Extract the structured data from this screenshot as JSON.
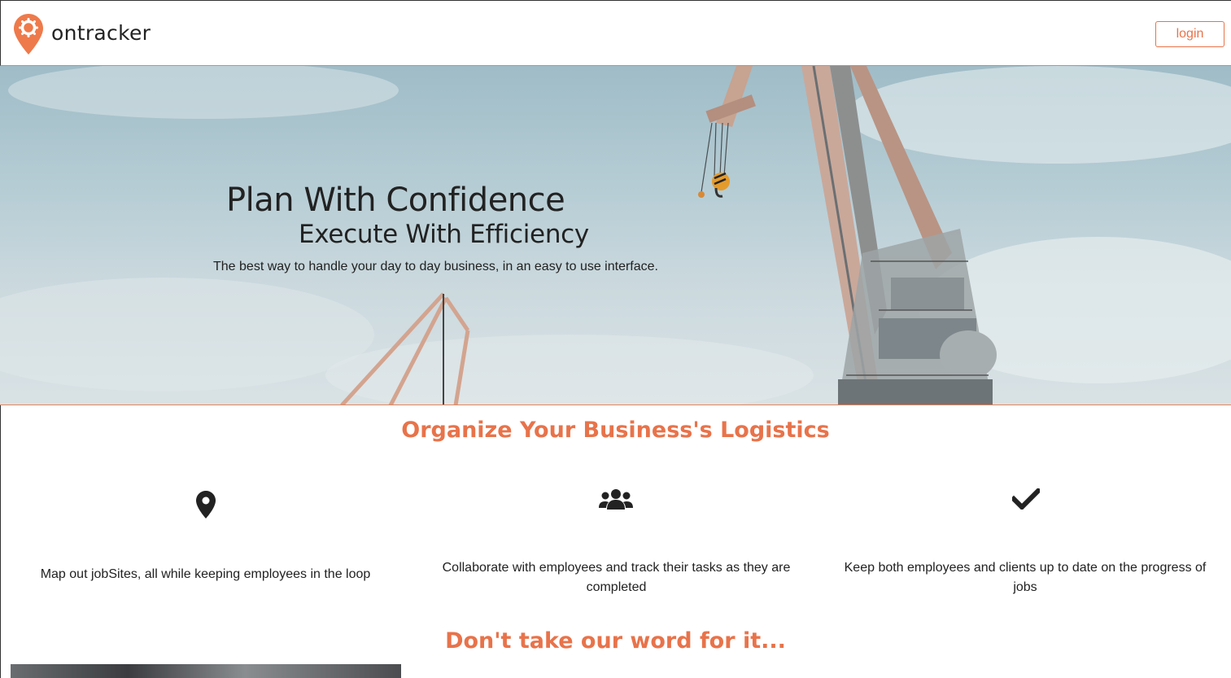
{
  "brand": {
    "name": "ontracker",
    "accent": "#e8734a"
  },
  "nav": {
    "login_label": "login"
  },
  "hero": {
    "title": "Plan With Confidence",
    "subtitle": "Execute With Efficiency",
    "tagline": "The best way to handle your day to day business, in an easy to use interface."
  },
  "features_section": {
    "title": "Organize Your Business's Logistics",
    "items": [
      {
        "icon": "map-marker-icon",
        "text": "Map out jobSites, all while keeping employees in the loop"
      },
      {
        "icon": "users-icon",
        "text": "Collaborate with employees and track their tasks as they are completed"
      },
      {
        "icon": "checkmark-icon",
        "text": "Keep both employees and clients up to date on the progress of jobs"
      }
    ]
  },
  "testimonials_section": {
    "title": "Don't take our word for it..."
  }
}
